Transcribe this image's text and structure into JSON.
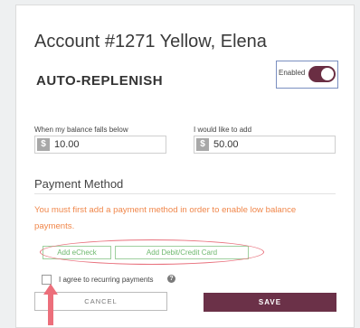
{
  "account": {
    "title": "Account #1271 Yellow, Elena"
  },
  "auto_replenish": {
    "heading": "AUTO-REPLENISH",
    "toggle_label": "Enabled",
    "toggle_on": true
  },
  "fields": {
    "balance_label": "When my balance falls below",
    "balance_currency": "$",
    "balance_value": "10.00",
    "add_label": "I would like to add",
    "add_currency": "$",
    "add_value": "50.00"
  },
  "payment": {
    "title": "Payment Method",
    "warning": "You must first add a payment method in order to enable low balance payments.",
    "add_echeck": "Add eCheck",
    "add_card": "Add Debit/Credit Card"
  },
  "agreement": {
    "label": "I agree to recurring payments",
    "help_icon": "?",
    "checked": false
  },
  "actions": {
    "cancel": "CANCEL",
    "save": "SAVE"
  },
  "colors": {
    "accent": "#6b3148",
    "warning": "#f0874b",
    "link_green": "#6fb86f",
    "annotation_red": "#e8707c"
  },
  "icons": {
    "currency": "dollar-icon",
    "help": "question-circle-icon",
    "annotation": "arrow-up-icon"
  }
}
